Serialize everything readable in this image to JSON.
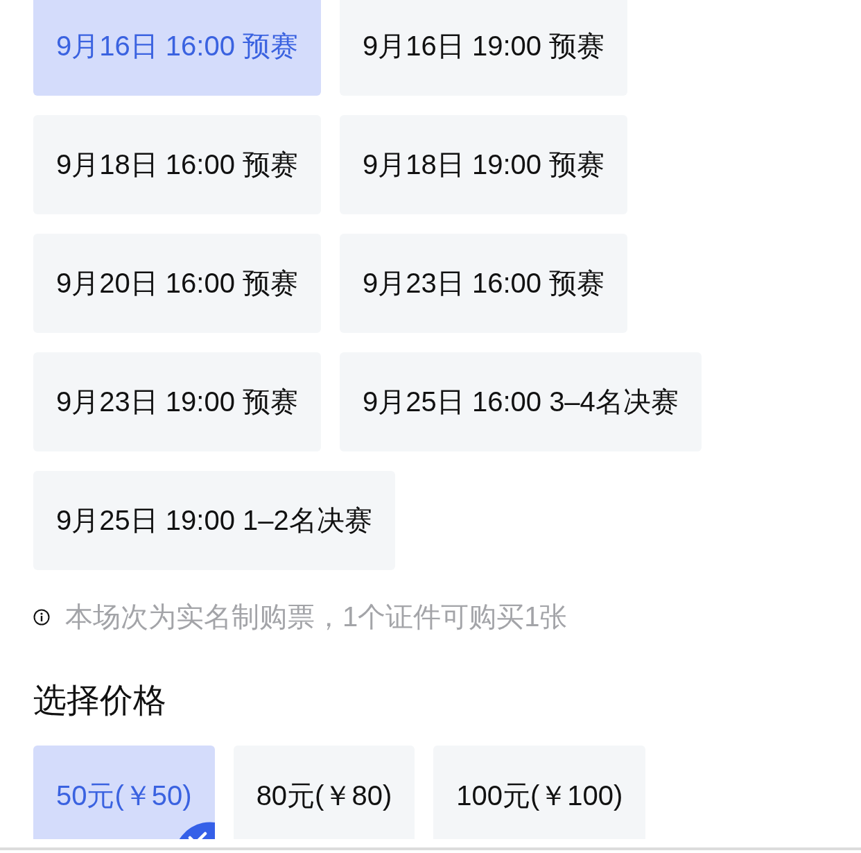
{
  "sessions": [
    {
      "label": "9月16日 16:00 预赛",
      "selected": true
    },
    {
      "label": "9月16日 19:00 预赛",
      "selected": false
    },
    {
      "label": "9月18日 16:00 预赛",
      "selected": false
    },
    {
      "label": "9月18日 19:00 预赛",
      "selected": false
    },
    {
      "label": "9月20日 16:00 预赛",
      "selected": false
    },
    {
      "label": "9月23日 16:00 预赛",
      "selected": false
    },
    {
      "label": "9月23日 19:00 预赛",
      "selected": false
    },
    {
      "label": "9月25日 16:00 3–4名决赛",
      "selected": false
    },
    {
      "label": "9月25日 19:00 1–2名决赛",
      "selected": false
    }
  ],
  "notice": "本场次为实名制购票，1个证件可购买1张",
  "price_section": {
    "title": "选择价格",
    "prices": [
      {
        "label": "50元(￥50)",
        "selected": true
      },
      {
        "label": "80元(￥80)",
        "selected": false
      },
      {
        "label": "100元(￥100)",
        "selected": false
      }
    ]
  }
}
